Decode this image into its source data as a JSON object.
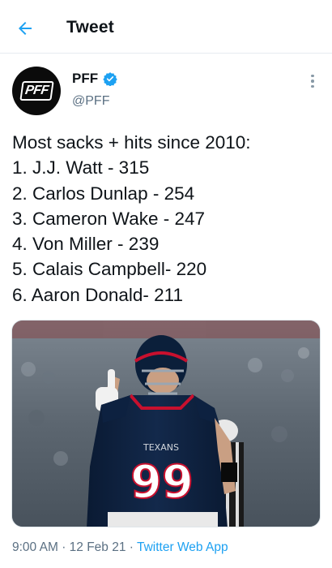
{
  "header": {
    "title": "Tweet"
  },
  "author": {
    "name": "PFF",
    "handle": "@PFF",
    "avatar_text": "PFF",
    "verified": true
  },
  "tweet": {
    "lines": [
      "Most sacks + hits since 2010:",
      "1. J.J. Watt - 315",
      "2. Carlos Dunlap - 254",
      "3. Cameron Wake - 247",
      "4. Von Miller - 239",
      "5. Calais Campbell- 220",
      "6. Aaron Donald- 211"
    ]
  },
  "media": {
    "jersey_number": "99",
    "jersey_team": "TEXANS"
  },
  "meta": {
    "time": "9:00 AM",
    "date": "12 Feb 21",
    "app": "Twitter Web App",
    "separator": "·"
  },
  "colors": {
    "accent": "#1da1f2",
    "text": "#0f1419",
    "secondary": "#5b7083",
    "jersey": "#0b1f3a",
    "jersey_red": "#c8102e"
  },
  "icons": {
    "back": "arrow-left-icon",
    "verified": "verified-badge-icon",
    "more": "more-vertical-icon"
  }
}
